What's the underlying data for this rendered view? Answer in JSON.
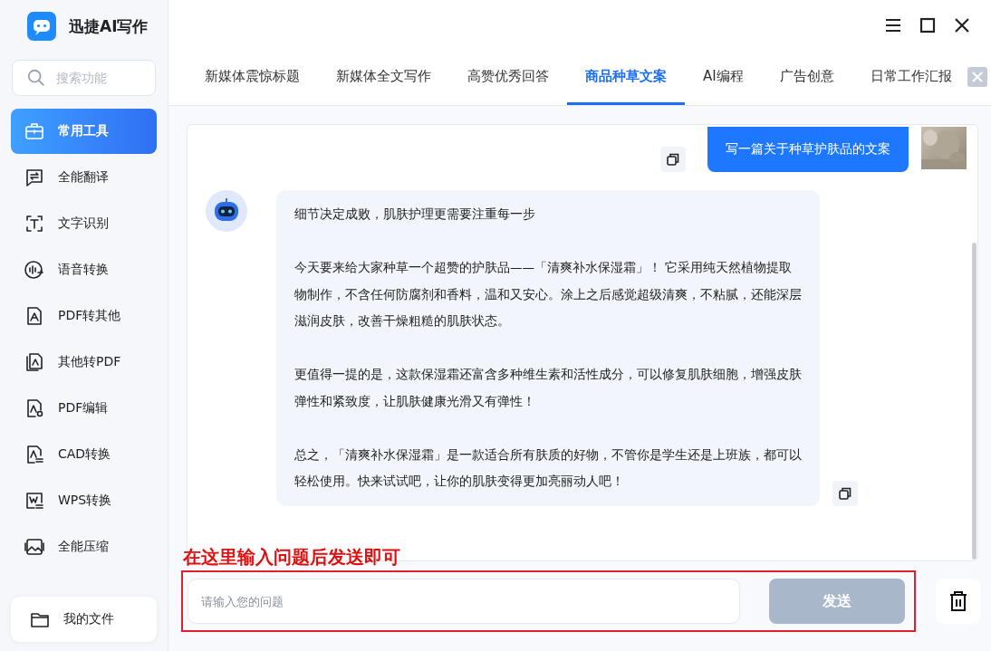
{
  "app": {
    "title": "迅捷AI写作"
  },
  "search": {
    "placeholder": "搜索功能"
  },
  "sidebar": {
    "items": [
      {
        "label": "常用工具",
        "selected": true
      },
      {
        "label": "全能翻译",
        "selected": false
      },
      {
        "label": "文字识别",
        "selected": false
      },
      {
        "label": "语音转换",
        "selected": false
      },
      {
        "label": "PDF转其他",
        "selected": false
      },
      {
        "label": "其他转PDF",
        "selected": false
      },
      {
        "label": "PDF编辑",
        "selected": false
      },
      {
        "label": "CAD转换",
        "selected": false
      },
      {
        "label": "WPS转换",
        "selected": false
      },
      {
        "label": "全能压缩",
        "selected": false
      }
    ],
    "footer": {
      "label": "我的文件"
    }
  },
  "tabs": [
    {
      "label": "新媒体震惊标题",
      "selected": false
    },
    {
      "label": "新媒体全文写作",
      "selected": false
    },
    {
      "label": "高赞优秀回答",
      "selected": false
    },
    {
      "label": "商品种草文案",
      "selected": true
    },
    {
      "label": "AI编程",
      "selected": false
    },
    {
      "label": "广告创意",
      "selected": false
    },
    {
      "label": "日常工作汇报",
      "selected": false
    }
  ],
  "chat": {
    "messages": [
      {
        "kind": "user",
        "text": "写一篇关于种草护肤品的文案"
      },
      {
        "kind": "assistant",
        "paragraphs": [
          "细节决定成败，肌肤护理更需要注重每一步",
          "今天要来给大家种草一个超赞的护肤品——「清爽补水保湿霜」！ 它采用纯天然植物提取物制作，不含任何防腐剂和香料，温和又安心。涂上之后感觉超级清爽，不粘腻，还能深层滋润皮肤，改善干燥粗糙的肌肤状态。",
          "更值得一提的是，这款保湿霜还富含多种维生素和活性成分，可以修复肌肤细胞，增强皮肤弹性和紧致度，让肌肤健康光滑又有弹性！",
          "总之，「清爽补水保湿霜」是一款适合所有肤质的好物，不管你是学生还是上班族，都可以轻松使用。快来试试吧，让你的肌肤变得更加亮丽动人吧！"
        ]
      }
    ]
  },
  "hint": "在这里输入问题后发送即可",
  "input": {
    "placeholder": "请输入您的问题"
  },
  "send_button": {
    "label": "发送",
    "disabled": true
  }
}
